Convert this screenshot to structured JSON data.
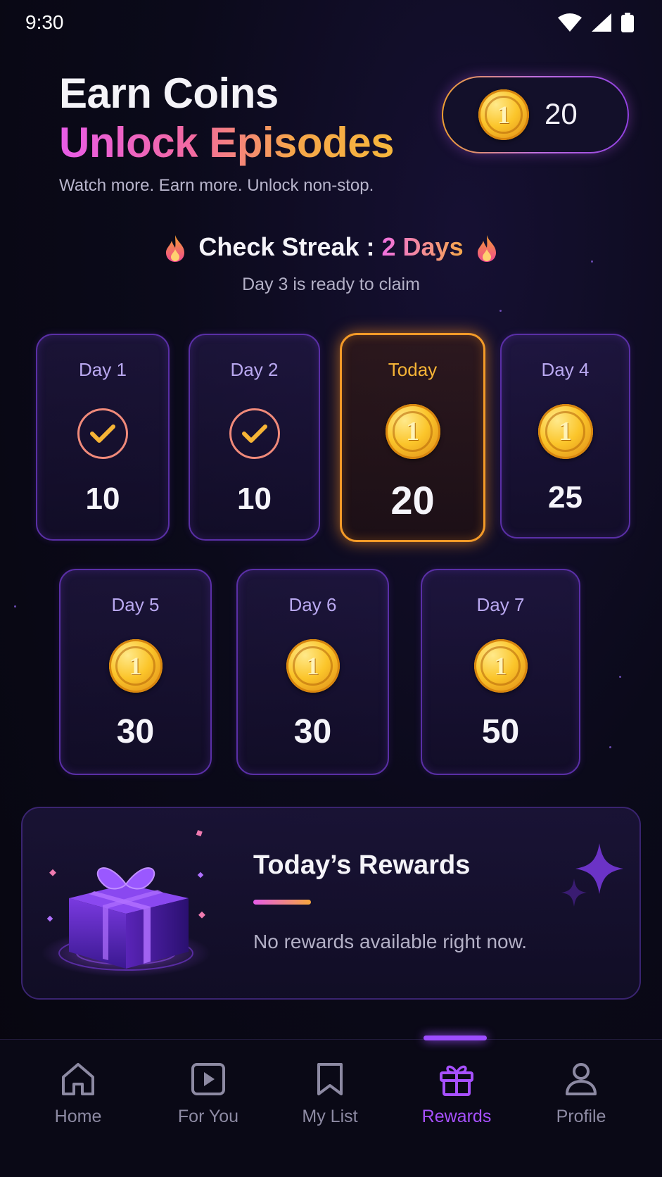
{
  "status_bar": {
    "time": "9:30"
  },
  "header": {
    "title_line1": "Earn Coins",
    "title_line2": "Unlock Episodes",
    "subtitle": "Watch more. Earn more. Unlock non-stop."
  },
  "coin_balance": {
    "value": "20",
    "icon": "coin-icon"
  },
  "streak": {
    "label": "Check Streak : ",
    "days": "2 Days",
    "subtext": "Day 3 is ready to claim"
  },
  "days": [
    {
      "label": "Day 1",
      "value": "10",
      "state": "claimed"
    },
    {
      "label": "Day 2",
      "value": "10",
      "state": "claimed"
    },
    {
      "label": "Today",
      "value": "20",
      "state": "today"
    },
    {
      "label": "Day 4",
      "value": "25",
      "state": "upcoming"
    },
    {
      "label": "Day 5",
      "value": "30",
      "state": "upcoming"
    },
    {
      "label": "Day 6",
      "value": "30",
      "state": "upcoming"
    },
    {
      "label": "Day 7",
      "value": "50",
      "state": "upcoming"
    }
  ],
  "rewards": {
    "title": "Today’s Rewards",
    "message": "No rewards available right now."
  },
  "nav": {
    "items": [
      {
        "label": "Home",
        "icon": "home-icon"
      },
      {
        "label": "For You",
        "icon": "play-icon"
      },
      {
        "label": "My List",
        "icon": "bookmark-icon"
      },
      {
        "label": "Rewards",
        "icon": "gift-icon",
        "active": true
      },
      {
        "label": "Profile",
        "icon": "profile-icon"
      }
    ]
  },
  "colors": {
    "accent": "#a750ff",
    "today_border": "#f39a28",
    "card_border": "#5a2fa6",
    "gold": "#fbc52a"
  }
}
